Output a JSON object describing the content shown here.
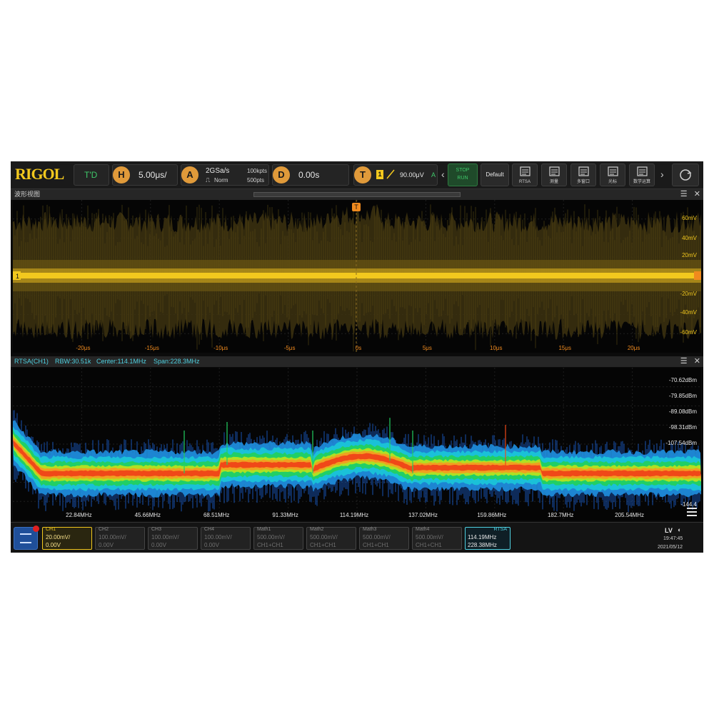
{
  "brand": "RIGOL",
  "toolbar": {
    "mode": "T'D",
    "h_label": "H",
    "timebase": "5.00μs/",
    "a_label": "A",
    "sample_rate": "2GSa/s",
    "memory_depth": "100kpts",
    "acq_mode": "Norm",
    "acq_rate": "500pts",
    "d_label": "D",
    "delay": "0.00s",
    "t_label": "T",
    "trig_channel": "1",
    "trig_level": "90.00μV",
    "trig_flag": "A",
    "run_state": "STOP",
    "run_sub": "RUN",
    "default_label": "Default",
    "tools": [
      {
        "name": "rtsa-tool",
        "label": "RTSA"
      },
      {
        "name": "measure-tool",
        "label": "测量"
      },
      {
        "name": "multi-window-tool",
        "label": "多窗口"
      },
      {
        "name": "cursor-tool",
        "label": "光标"
      },
      {
        "name": "math-tool",
        "label": "数学运算"
      }
    ]
  },
  "waveform_panel": {
    "title": "波形视图",
    "y_labels": [
      "60mV",
      "40mV",
      "20mV",
      "-20mV",
      "-40mV",
      "-60mV"
    ],
    "x_labels": [
      "-20μs",
      "-15μs",
      "-10μs",
      "-5μs",
      "0s",
      "5μs",
      "10μs",
      "15μs",
      "20μs"
    ],
    "channel_marker": "1",
    "trigger_marker": "T"
  },
  "spectrum_panel": {
    "title": "RTSA(CH1)",
    "rbw": "RBW:30.51k",
    "center": "Center:114.1MHz",
    "span": "Span:228.3MHz",
    "y_labels": [
      "-70.62dBm",
      "-79.85dBm",
      "-89.08dBm",
      "-98.31dBm",
      "-107.54dBm",
      "-144.4"
    ],
    "x_labels": [
      "22.84MHz",
      "45.66MHz",
      "68.51MHz",
      "91.33MHz",
      "114.19MHz",
      "137.02MHz",
      "159.86MHz",
      "182.7MHz",
      "205.54MHz"
    ]
  },
  "channels": [
    {
      "name": "CH1",
      "scale": "20.00mV/",
      "offset": "0.00V",
      "active": true
    },
    {
      "name": "CH2",
      "scale": "100.00mV/",
      "offset": "0.00V"
    },
    {
      "name": "CH3",
      "scale": "100.00mV/",
      "offset": "0.00V"
    },
    {
      "name": "CH4",
      "scale": "100.00mV/",
      "offset": "0.00V"
    },
    {
      "name": "Math1",
      "scale": "500.00mV/",
      "offset": "CH1+CH1"
    },
    {
      "name": "Math2",
      "scale": "500.00mV/",
      "offset": "CH1+CH1"
    },
    {
      "name": "Math3",
      "scale": "500.00mV/",
      "offset": "CH1+CH1"
    },
    {
      "name": "Math4",
      "scale": "500.00mV/",
      "offset": "CH1+CH1"
    }
  ],
  "rtsa_box": {
    "name": "RTSA",
    "center": "114.19MHz",
    "span": "228.38MHz"
  },
  "status": {
    "lv": "LV",
    "time": "19:47:45",
    "date": "2021/05/12"
  },
  "colors": {
    "ch1": "#f2c81e",
    "trigger": "#f08a1e",
    "accent": "#4fd0e0"
  }
}
